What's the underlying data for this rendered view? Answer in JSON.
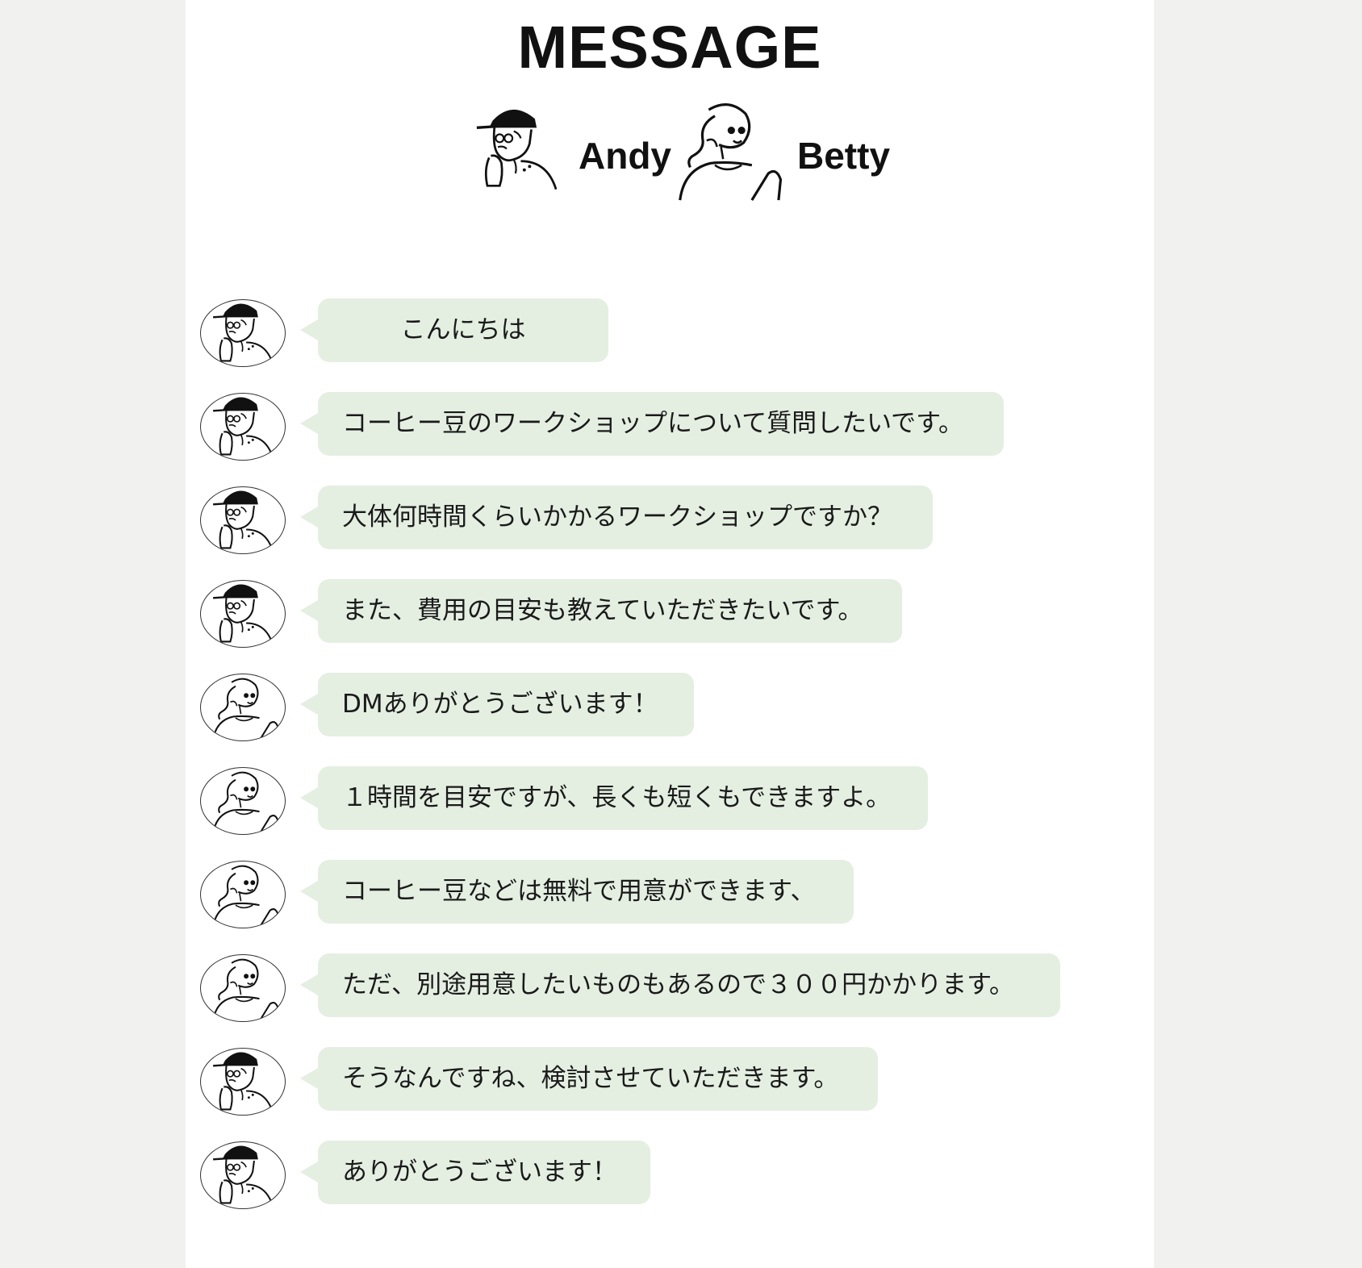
{
  "header": {
    "title": "MESSAGE",
    "participants": [
      {
        "name": "Andy",
        "icon": "andy-illustration-icon"
      },
      {
        "name": "Betty",
        "icon": "betty-illustration-icon"
      }
    ]
  },
  "chat": {
    "bubble_color": "#e4efe2",
    "messages": [
      {
        "sender": "Andy",
        "text": "こんにちは"
      },
      {
        "sender": "Andy",
        "text": "コーヒー豆のワークショップについて質問したいです。"
      },
      {
        "sender": "Andy",
        "text": "大体何時間くらいかかるワークショップですか？"
      },
      {
        "sender": "Andy",
        "text": "また、費用の目安も教えていただきたいです。"
      },
      {
        "sender": "Betty",
        "text": "DMありがとうございます！"
      },
      {
        "sender": "Betty",
        "text": "１時間を目安ですが、長くも短くもできますよ。"
      },
      {
        "sender": "Betty",
        "text": "コーヒー豆などは無料で用意ができます、"
      },
      {
        "sender": "Betty",
        "text": "ただ、別途用意したいものもあるので３００円かかります。"
      },
      {
        "sender": "Andy",
        "text": "そうなんですね、検討させていただきます。"
      },
      {
        "sender": "Andy",
        "text": "ありがとうございます！"
      }
    ]
  }
}
